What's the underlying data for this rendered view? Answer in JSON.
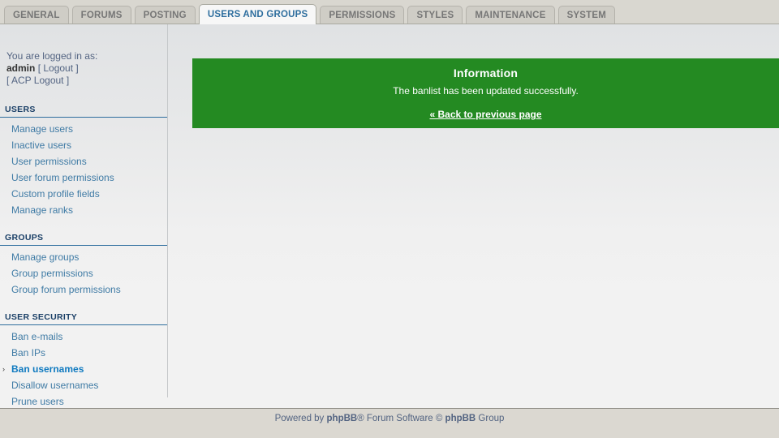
{
  "tabs": [
    {
      "label": "GENERAL",
      "active": false
    },
    {
      "label": "FORUMS",
      "active": false
    },
    {
      "label": "POSTING",
      "active": false
    },
    {
      "label": "USERS AND GROUPS",
      "active": true
    },
    {
      "label": "PERMISSIONS",
      "active": false
    },
    {
      "label": "STYLES",
      "active": false
    },
    {
      "label": "MAINTENANCE",
      "active": false
    },
    {
      "label": "SYSTEM",
      "active": false
    }
  ],
  "sidebar": {
    "login": {
      "intro": "You are logged in as:",
      "username": "admin",
      "logout": "[ Logout ]",
      "acp_logout": "[ ACP Logout ]"
    },
    "groups": [
      {
        "heading": "USERS",
        "items": [
          {
            "label": "Manage users",
            "active": false
          },
          {
            "label": "Inactive users",
            "active": false
          },
          {
            "label": "User permissions",
            "active": false
          },
          {
            "label": "User forum permissions",
            "active": false
          },
          {
            "label": "Custom profile fields",
            "active": false
          },
          {
            "label": "Manage ranks",
            "active": false
          }
        ]
      },
      {
        "heading": "GROUPS",
        "items": [
          {
            "label": "Manage groups",
            "active": false
          },
          {
            "label": "Group permissions",
            "active": false
          },
          {
            "label": "Group forum permissions",
            "active": false
          }
        ]
      },
      {
        "heading": "USER SECURITY",
        "items": [
          {
            "label": "Ban e-mails",
            "active": false
          },
          {
            "label": "Ban IPs",
            "active": false
          },
          {
            "label": "Ban usernames",
            "active": true
          },
          {
            "label": "Disallow usernames",
            "active": false
          },
          {
            "label": "Prune users",
            "active": false
          }
        ]
      }
    ],
    "active_marker": "›"
  },
  "main": {
    "info": {
      "title": "Information",
      "message": "The banlist has been updated successfully.",
      "back_link": "« Back to previous page"
    }
  },
  "footer": {
    "prefix": "Powered by ",
    "brand": "phpBB",
    "suffix": "® Forum Software © ",
    "brand2": "phpBB",
    "suffix2": " Group"
  },
  "colors": {
    "accent": "#2e6e9e",
    "success": "#248a22",
    "tabbar": "#d9d7d0",
    "link": "#3f7ba5",
    "active_link": "#0f7ac0"
  }
}
